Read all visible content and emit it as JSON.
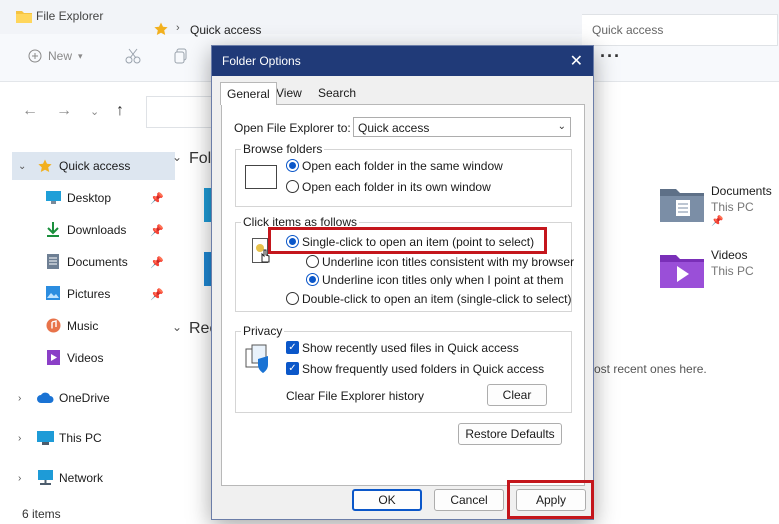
{
  "explorer": {
    "title": "File Explorer",
    "toolbar": {
      "new_label": "New"
    },
    "address": "Quick access",
    "search_text": "Quick access",
    "sidebar": {
      "items": [
        {
          "label": "Quick access",
          "icon": "star-icon"
        },
        {
          "label": "Desktop",
          "icon": "desktop-icon",
          "pinned": true
        },
        {
          "label": "Downloads",
          "icon": "download-icon",
          "pinned": true
        },
        {
          "label": "Documents",
          "icon": "document-icon",
          "pinned": true
        },
        {
          "label": "Pictures",
          "icon": "pictures-icon",
          "pinned": true
        },
        {
          "label": "Music",
          "icon": "music-icon"
        },
        {
          "label": "Videos",
          "icon": "videos-icon"
        },
        {
          "label": "OneDrive",
          "icon": "cloud-icon"
        },
        {
          "label": "This PC",
          "icon": "computer-icon"
        },
        {
          "label": "Network",
          "icon": "network-icon"
        }
      ]
    },
    "content": {
      "folders_heading": "Folde",
      "recent_heading": "Rec",
      "tiles": [
        {
          "name": "Documents",
          "sub": "This PC"
        },
        {
          "name": "Videos",
          "sub": "This PC"
        }
      ],
      "recent_msg": "ost recent ones here."
    },
    "status": "6 items"
  },
  "dialog": {
    "title": "Folder Options",
    "tabs": [
      "General",
      "View",
      "Search"
    ],
    "open_to_label": "Open File Explorer to:",
    "open_to_value": "Quick access",
    "browse_group": "Browse folders",
    "browse_same": "Open each folder in the same window",
    "browse_own": "Open each folder in its own window",
    "click_group": "Click items as follows",
    "single_click": "Single-click to open an item (point to select)",
    "underline_browser": "Underline icon titles consistent with my browser",
    "underline_point": "Underline icon titles only when I point at them",
    "double_click": "Double-click to open an item (single-click to select)",
    "privacy_group": "Privacy",
    "show_recent": "Show recently used files in Quick access",
    "show_frequent": "Show frequently used folders in Quick access",
    "clear_history_label": "Clear File Explorer history",
    "clear_button": "Clear",
    "restore_button": "Restore Defaults",
    "ok_button": "OK",
    "cancel_button": "Cancel",
    "apply_button": "Apply",
    "colors": {
      "titlebar": "#203a78",
      "accent": "#0b57c9",
      "highlight": "#c4161c"
    }
  }
}
